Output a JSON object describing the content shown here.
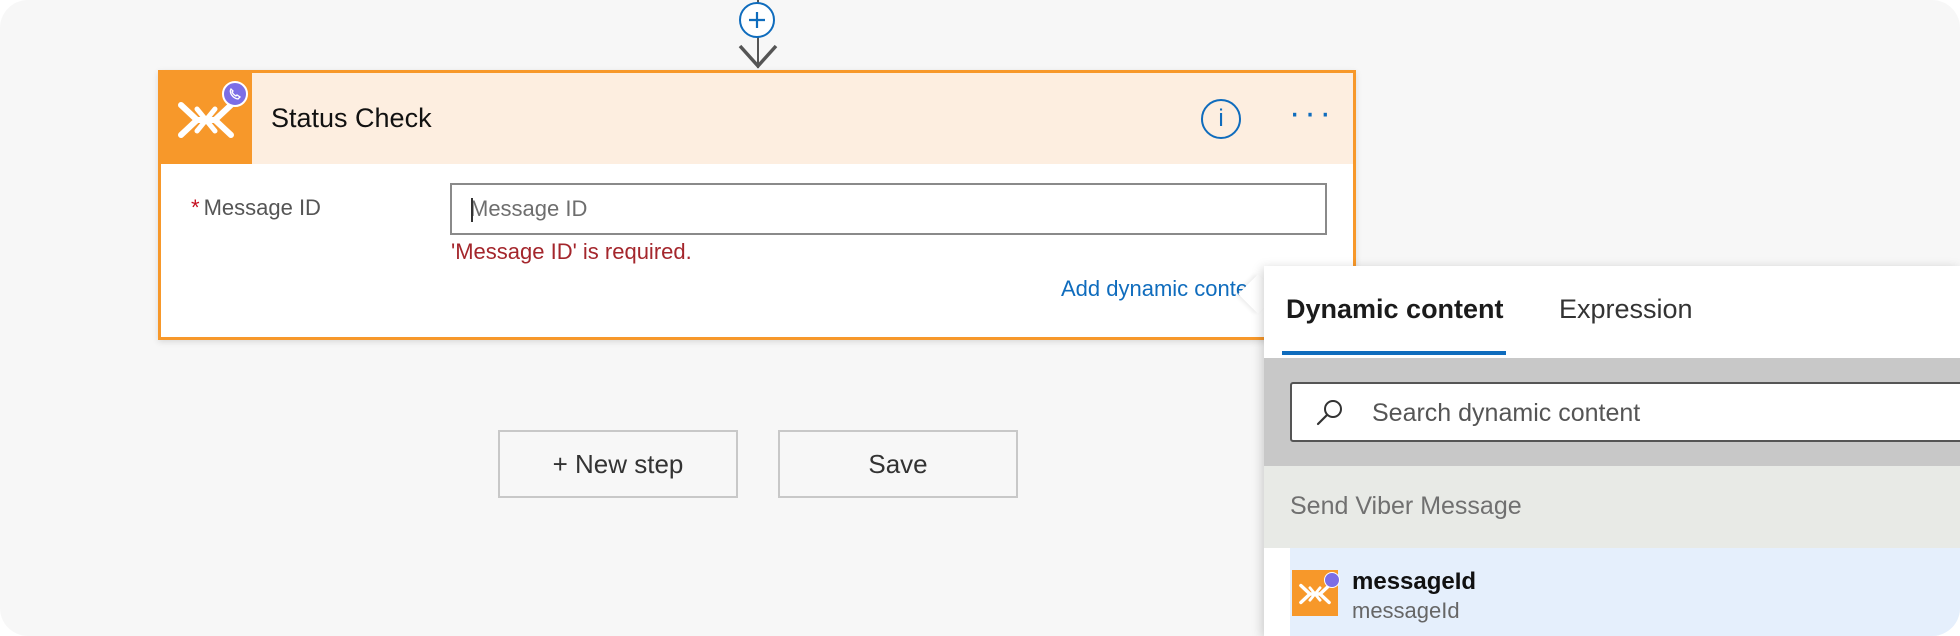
{
  "card": {
    "title": "Status Check",
    "field_label": "Message ID",
    "required_mark": "*",
    "field_placeholder": "Message ID",
    "field_value": "",
    "error": "'Message ID' is required.",
    "add_dynamic": "Add dynamic content",
    "info_label": "i",
    "more_label": "···",
    "connector_color": "#f7982a"
  },
  "buttons": {
    "new_step": "+ New step",
    "save": "Save"
  },
  "dynamic_panel": {
    "tabs": [
      "Dynamic content",
      "Expression"
    ],
    "active_tab": "Dynamic content",
    "search_placeholder": "Search dynamic content",
    "section_title": "Send Viber Message",
    "items": [
      {
        "title": "messageId",
        "subtitle": "messageId"
      }
    ]
  },
  "icons": [
    "add-step-icon",
    "arrow-down-icon",
    "connector-logo-icon",
    "viber-badge-icon",
    "info-icon",
    "more-icon",
    "search-icon"
  ],
  "colors": {
    "accent": "#0f6cbd",
    "connector": "#f7982a",
    "header_bg": "#fdeee0",
    "error": "#a4262c",
    "viber": "#7c6ee6"
  }
}
